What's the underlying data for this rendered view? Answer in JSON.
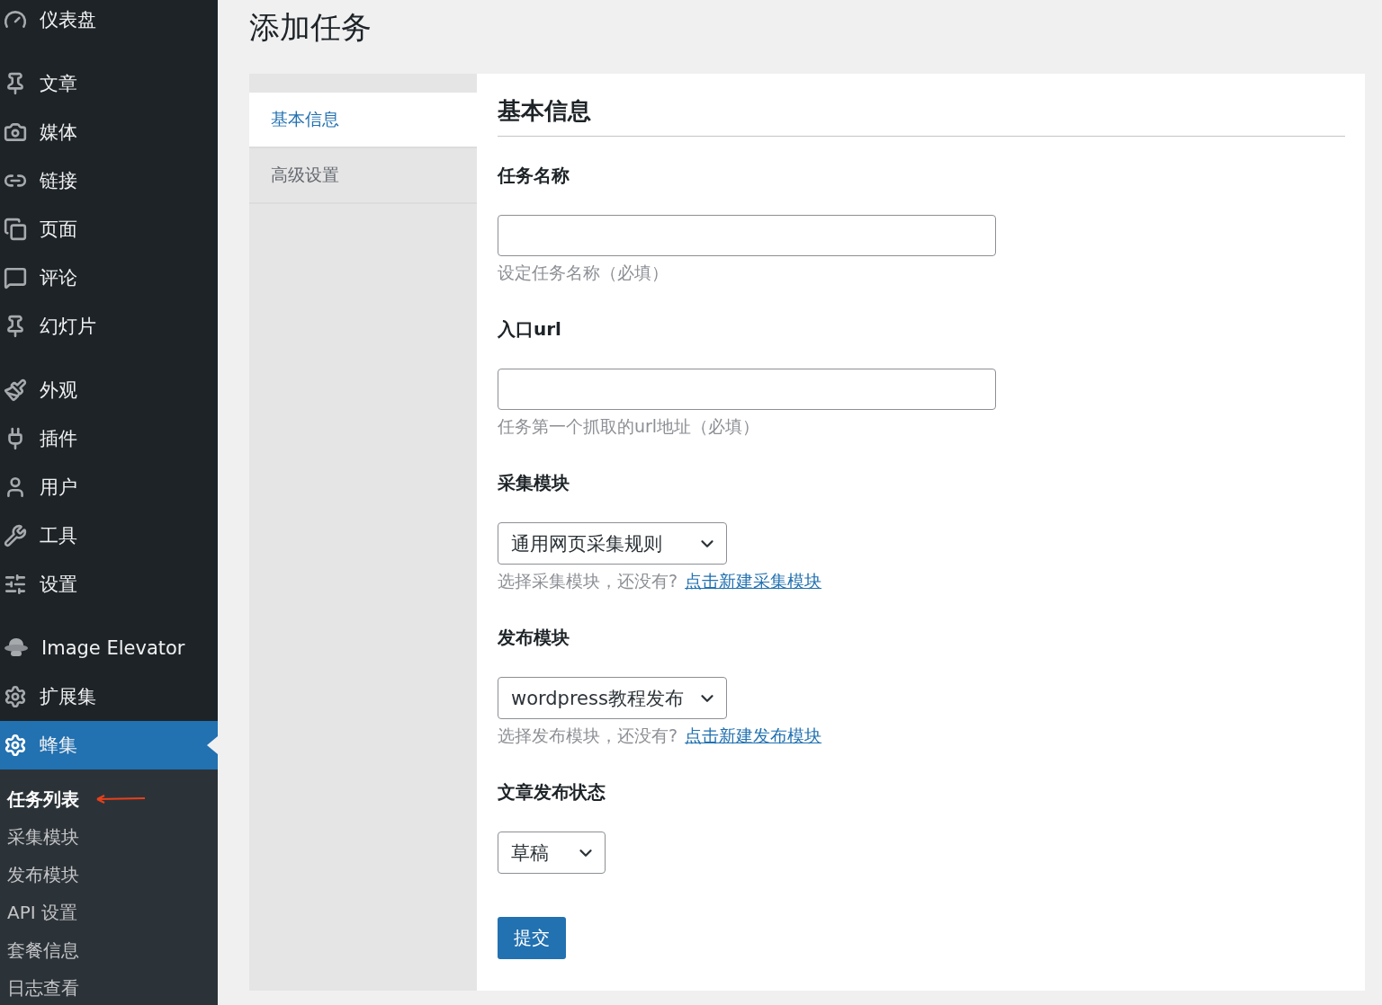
{
  "sidebar": {
    "menu_groups": [
      [
        {
          "label": "仪表盘",
          "selected": false
        }
      ],
      [
        {
          "label": "文章",
          "selected": false
        },
        {
          "label": "媒体",
          "selected": false
        },
        {
          "label": "链接",
          "selected": false
        },
        {
          "label": "页面",
          "selected": false
        },
        {
          "label": "评论",
          "selected": false
        },
        {
          "label": "幻灯片",
          "selected": false
        }
      ],
      [
        {
          "label": "外观",
          "selected": false
        },
        {
          "label": "插件",
          "selected": false
        },
        {
          "label": "用户",
          "selected": false
        },
        {
          "label": "工具",
          "selected": false
        },
        {
          "label": "设置",
          "selected": false
        }
      ],
      [
        {
          "label": "Image Elevator",
          "selected": false
        },
        {
          "label": "扩展集",
          "selected": false
        },
        {
          "label": "蜂集",
          "selected": true
        }
      ]
    ],
    "submenu": [
      {
        "label": "任务列表",
        "selected": true
      },
      {
        "label": "采集模块",
        "selected": false
      },
      {
        "label": "发布模块",
        "selected": false
      },
      {
        "label": "API 设置",
        "selected": false
      },
      {
        "label": "套餐信息",
        "selected": false
      },
      {
        "label": "日志查看",
        "selected": false
      }
    ]
  },
  "page_title": "添加任务",
  "tabs": [
    {
      "label": "基本信息",
      "selected": true
    },
    {
      "label": "高级设置",
      "selected": false
    }
  ],
  "section_title": "基本信息",
  "fields": [
    {
      "kind": "text",
      "label": "任务名称",
      "help": "设定任务名称（必填）"
    },
    {
      "kind": "text",
      "label": "入口url",
      "help": "任务第一个抓取的url地址（必填）"
    },
    {
      "kind": "select",
      "label": "采集模块",
      "value": "通用网页采集规则",
      "help": "选择采集模块，还没有?",
      "link": "点击新建采集模块"
    },
    {
      "kind": "select",
      "label": "发布模块",
      "value": "wordpress教程发布",
      "help": "选择发布模块，还没有?",
      "link": "点击新建发布模块"
    },
    {
      "kind": "select",
      "label": "文章发布状态",
      "value": "草稿"
    }
  ],
  "submit": "提交"
}
